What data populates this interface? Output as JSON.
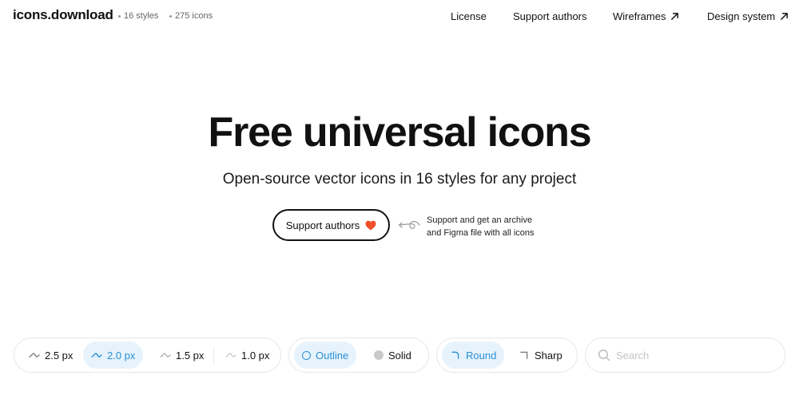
{
  "header": {
    "logo": "icons.download",
    "styles_count": "16 styles",
    "icons_count": "275 icons",
    "nav": {
      "license": "License",
      "support": "Support authors",
      "wireframes": "Wireframes",
      "design_system": "Design system"
    }
  },
  "hero": {
    "title": "Free universal icons",
    "subtitle": "Open-source vector icons in 16 styles for any project",
    "support_button": "Support authors",
    "support_note_line1": "Support and get an archive",
    "support_note_line2": "and Figma file with all icons"
  },
  "toolbar": {
    "stroke_options": [
      {
        "label": "2.5 px",
        "active": false
      },
      {
        "label": "2.0 px",
        "active": true
      },
      {
        "label": "1.5 px",
        "active": false
      },
      {
        "label": "1.0 px",
        "active": false
      }
    ],
    "style_options": [
      {
        "label": "Outline",
        "active": true
      },
      {
        "label": "Solid",
        "active": false
      }
    ],
    "corner_options": [
      {
        "label": "Round",
        "active": true
      },
      {
        "label": "Sharp",
        "active": false
      }
    ],
    "search_placeholder": "Search"
  },
  "colors": {
    "accent": "#2b8fd6",
    "accent_bg": "#e6f3fc",
    "heart": "#f0502a",
    "text": "#111111"
  },
  "icons": {
    "nav_external": "arrow-up-right-icon",
    "heart": "heart-icon",
    "stroke": "squiggle-icon",
    "search": "search-icon"
  }
}
